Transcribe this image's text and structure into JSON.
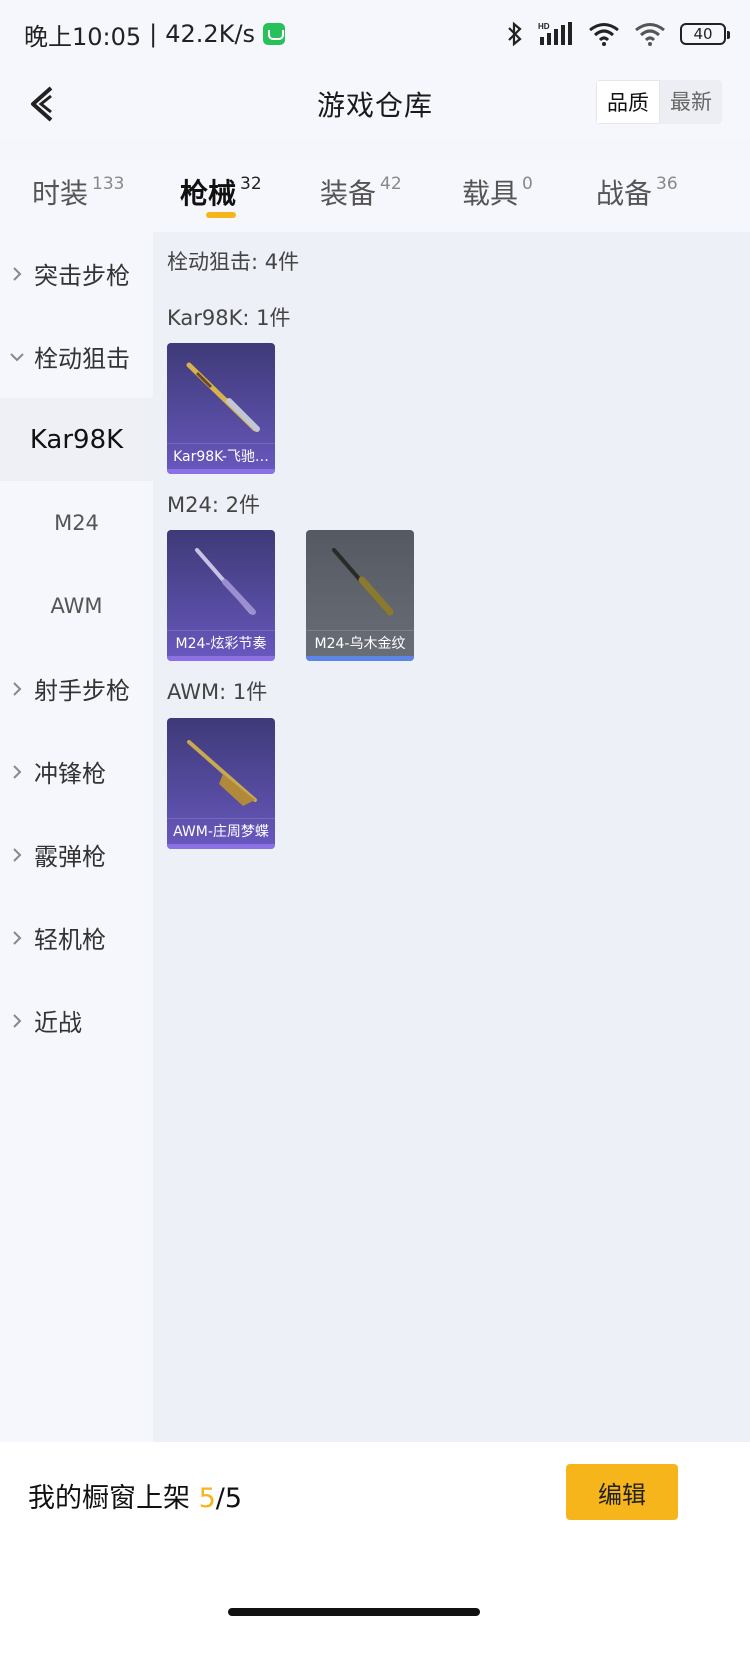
{
  "status_bar": {
    "time": "晚上10:05",
    "separator": "|",
    "speed": "42.2K/s",
    "battery": "40",
    "hd_label": "HD"
  },
  "header": {
    "title": "游戏仓库",
    "sort_options": [
      "品质",
      "最新"
    ],
    "active_sort": "品质"
  },
  "tabs": [
    {
      "label": "时装",
      "count": "133"
    },
    {
      "label": "枪械",
      "count": "32",
      "active": true
    },
    {
      "label": "装备",
      "count": "42"
    },
    {
      "label": "载具",
      "count": "0"
    },
    {
      "label": "战备",
      "count": "36"
    }
  ],
  "sidebar": {
    "categories": [
      {
        "label": "突击步枪",
        "expanded": false
      },
      {
        "label": "栓动狙击",
        "expanded": true
      },
      {
        "label": "射手步枪",
        "expanded": false
      },
      {
        "label": "冲锋枪",
        "expanded": false
      },
      {
        "label": "霰弹枪",
        "expanded": false
      },
      {
        "label": "轻机枪",
        "expanded": false
      },
      {
        "label": "近战",
        "expanded": false
      }
    ],
    "subitems": [
      {
        "label": "Kar98K",
        "active": true
      },
      {
        "label": "M24"
      },
      {
        "label": "AWM"
      }
    ]
  },
  "content": {
    "summary": "栓动狙击: 4件",
    "groups": [
      {
        "label": "Kar98K: 1件",
        "items": [
          {
            "name": "Kar98K-飞驰…",
            "style": "purple"
          }
        ]
      },
      {
        "label": "M24: 2件",
        "items": [
          {
            "name": "M24-炫彩节奏",
            "style": "purple"
          },
          {
            "name": "M24-乌木金纹",
            "style": "gray"
          }
        ]
      },
      {
        "label": "AWM: 1件",
        "items": [
          {
            "name": "AWM-庄周梦蝶",
            "style": "purple"
          }
        ]
      }
    ]
  },
  "bottom": {
    "showcase_label": "我的橱窗上架",
    "showcase_count": "5",
    "showcase_separator": "/",
    "showcase_total": "5",
    "edit_label": "编辑"
  },
  "colors": {
    "accent": "#f7b51c",
    "purple_card": "#5b4fa8",
    "gray_card": "#60646c"
  }
}
